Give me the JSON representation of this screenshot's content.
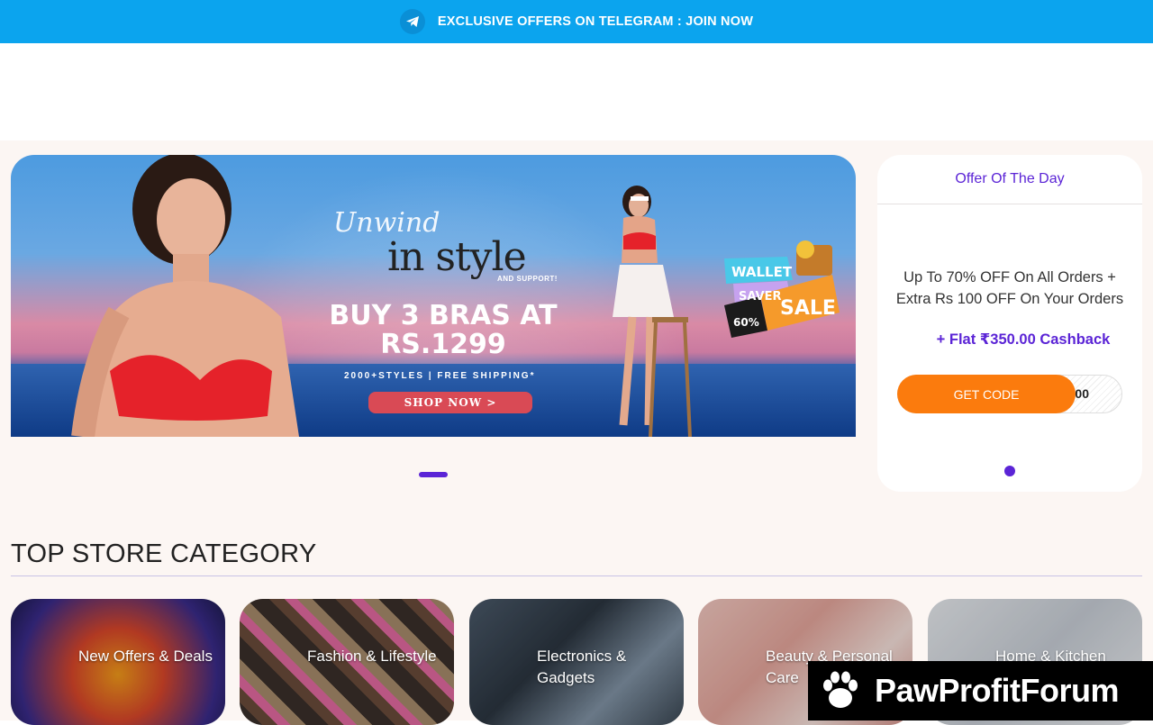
{
  "topbar": {
    "text": "EXCLUSIVE OFFERS ON TELEGRAM : JOIN NOW",
    "icon": "telegram-icon",
    "color": "#0ba4ee"
  },
  "banner": {
    "script_text": "Unwind",
    "brand_text": "in style",
    "tagline": "AND SUPPORT!",
    "headline_line1": "BUY 3 BRAS AT",
    "headline_line2": "RS.1299",
    "subline": "2000+STYLES  |  FREE SHIPPING*",
    "cta": "SHOP NOW >",
    "badge": {
      "line1": "WALLET",
      "line2": "SAVER",
      "line3": "SALE",
      "discount": "60%",
      "upto": "UPTO",
      "off": "OFF"
    }
  },
  "offer": {
    "title": "Offer Of The Day",
    "text": "Up To 70% OFF On All Orders + Extra Rs 100 OFF On Your Orders",
    "cashback": "+ Flat ₹350.00 Cashback",
    "button": "GET CODE",
    "code": "E100"
  },
  "section": {
    "title": "TOP STORE CATEGORY"
  },
  "categories": [
    {
      "label": "New Offers & Deals"
    },
    {
      "label": "Fashion & Lifestyle"
    },
    {
      "label": "Electronics & Gadgets"
    },
    {
      "label": "Beauty & Personal Care"
    },
    {
      "label": "Home & Kitchen"
    }
  ],
  "watermark": {
    "text": "PawProfitForum",
    "icon": "paw-icon"
  },
  "colors": {
    "accent": "#5b24d6",
    "orange": "#fb7b0d",
    "background": "#fcf6f3"
  }
}
